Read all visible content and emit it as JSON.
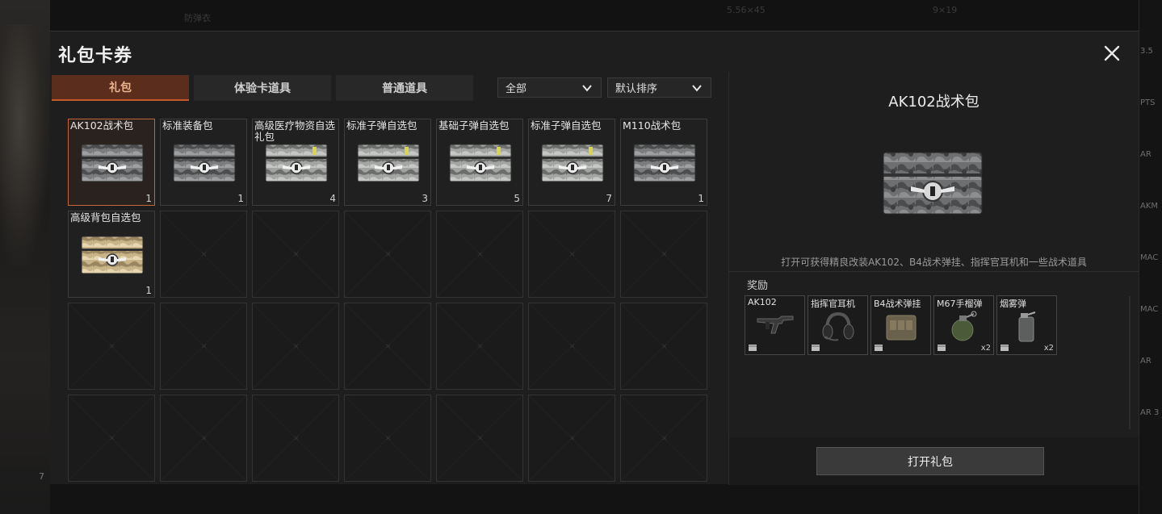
{
  "background": {
    "top_left_text": "防弹衣",
    "top_texts": [
      "5.56×45",
      "9×19"
    ],
    "right_items": [
      "3.5",
      "PTS",
      "AR",
      "AKM",
      "MAC",
      "MAC",
      "AR",
      "AR 3"
    ],
    "bottom_text": "7"
  },
  "modal": {
    "title": "礼包卡券",
    "close_icon": "close-icon"
  },
  "tabs": [
    {
      "label": "礼包",
      "active": true
    },
    {
      "label": "体验卡道具",
      "active": false
    },
    {
      "label": "普通道具",
      "active": false
    }
  ],
  "filters": {
    "category": "全部",
    "sort": "默认排序"
  },
  "items": [
    {
      "name": "AK102战术包",
      "qty": "1",
      "style": "camo",
      "selected": true
    },
    {
      "name": "标准装备包",
      "qty": "1",
      "style": "camo",
      "selected": false
    },
    {
      "name": "高级医疗物资自选礼包",
      "qty": "4",
      "style": "gray",
      "selected": false
    },
    {
      "name": "标准子弹自选包",
      "qty": "3",
      "style": "gray",
      "selected": false
    },
    {
      "name": "基础子弹自选包",
      "qty": "5",
      "style": "gray",
      "selected": false
    },
    {
      "name": "标准子弹自选包",
      "qty": "7",
      "style": "gray",
      "selected": false
    },
    {
      "name": "M110战术包",
      "qty": "1",
      "style": "camo",
      "selected": false
    },
    {
      "name": "高级背包自选包",
      "qty": "1",
      "style": "gold",
      "selected": false
    }
  ],
  "detail": {
    "title": "AK102战术包",
    "description": "打开可获得精良改装AK102、B4战术弹挂、指挥官耳机和一些战术道具",
    "rewards_label": "奖励",
    "rewards": [
      {
        "name": "AK102",
        "qty": "",
        "icon": "rifle-icon"
      },
      {
        "name": "指挥官耳机",
        "qty": "",
        "icon": "headset-icon"
      },
      {
        "name": "B4战术弹挂",
        "qty": "",
        "icon": "vest-icon"
      },
      {
        "name": "M67手榴弹",
        "qty": "x2",
        "icon": "grenade-icon"
      },
      {
        "name": "烟雾弹",
        "qty": "x2",
        "icon": "smoke-grenade-icon"
      }
    ],
    "open_button": "打开礼包"
  }
}
